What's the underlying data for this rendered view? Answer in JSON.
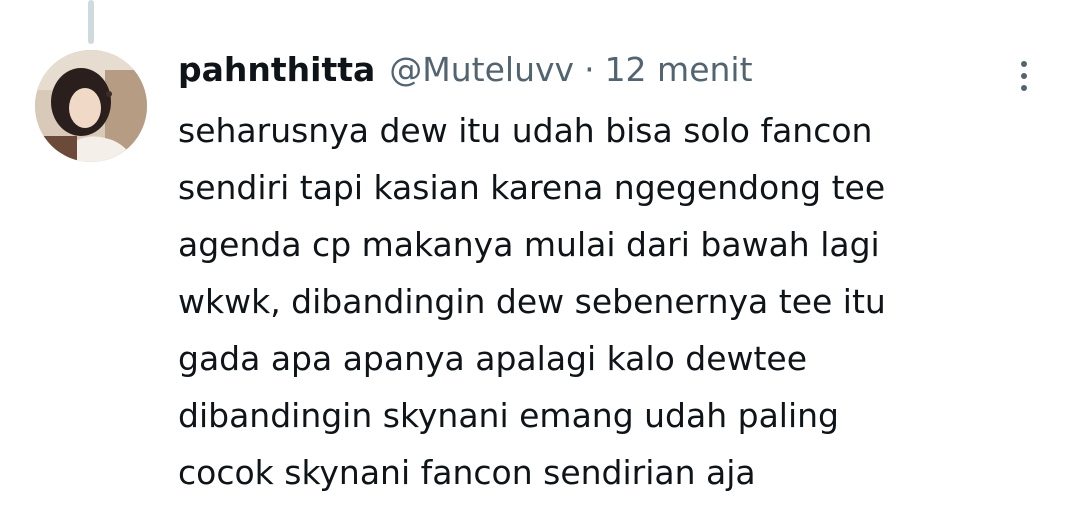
{
  "tweet": {
    "display_name": "pahnthitta",
    "handle": "@Muteluvv",
    "separator": "·",
    "time": "12 menit",
    "lines": [
      "seharusnya dew itu udah bisa solo fancon",
      "sendiri tapi kasian karena ngegendong tee",
      "agenda cp makanya mulai dari bawah lagi",
      "wkwk, dibandingin dew sebenernya tee itu",
      "gada apa apanya apalagi kalo dewtee",
      "dibandingin skynani emang udah paling",
      "cocok skynani fancon sendirian aja"
    ]
  },
  "icons": {
    "more": "more-vertical-icon",
    "avatar": "user-avatar"
  },
  "colors": {
    "text_primary": "#0f1419",
    "text_secondary": "#536471",
    "thread_line": "#cfd9de",
    "background": "#ffffff"
  }
}
